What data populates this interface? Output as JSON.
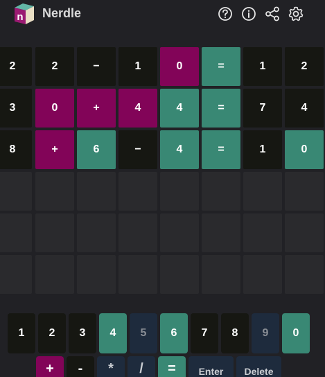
{
  "app": {
    "title": "Nerdle",
    "logo_letter": "n"
  },
  "header_icons": [
    "help-icon",
    "info-icon",
    "share-icon",
    "settings-icon"
  ],
  "colors": {
    "background": "#212125",
    "correct": "#398874",
    "wrong_position": "#820458",
    "absent": "#161712",
    "empty": "#2a2a2d",
    "key_unused": "#1e2b3d"
  },
  "board": {
    "rows": [
      [
        {
          "v": "2",
          "s": "absent"
        },
        {
          "v": "2",
          "s": "absent"
        },
        {
          "v": "−",
          "s": "absent"
        },
        {
          "v": "1",
          "s": "absent"
        },
        {
          "v": "0",
          "s": "wrong_position"
        },
        {
          "v": "=",
          "s": "correct"
        },
        {
          "v": "1",
          "s": "absent"
        },
        {
          "v": "2",
          "s": "absent"
        }
      ],
      [
        {
          "v": "3",
          "s": "absent"
        },
        {
          "v": "0",
          "s": "wrong_position"
        },
        {
          "v": "+",
          "s": "wrong_position"
        },
        {
          "v": "4",
          "s": "wrong_position"
        },
        {
          "v": "4",
          "s": "correct"
        },
        {
          "v": "=",
          "s": "correct"
        },
        {
          "v": "7",
          "s": "absent"
        },
        {
          "v": "4",
          "s": "absent"
        }
      ],
      [
        {
          "v": "8",
          "s": "absent"
        },
        {
          "v": "+",
          "s": "wrong_position"
        },
        {
          "v": "6",
          "s": "correct"
        },
        {
          "v": "−",
          "s": "absent"
        },
        {
          "v": "4",
          "s": "correct"
        },
        {
          "v": "=",
          "s": "correct"
        },
        {
          "v": "1",
          "s": "absent"
        },
        {
          "v": "0",
          "s": "correct"
        }
      ],
      [
        {
          "v": "",
          "s": "empty"
        },
        {
          "v": "",
          "s": "empty"
        },
        {
          "v": "",
          "s": "empty"
        },
        {
          "v": "",
          "s": "empty"
        },
        {
          "v": "",
          "s": "empty"
        },
        {
          "v": "",
          "s": "empty"
        },
        {
          "v": "",
          "s": "empty"
        },
        {
          "v": "",
          "s": "empty"
        }
      ],
      [
        {
          "v": "",
          "s": "empty"
        },
        {
          "v": "",
          "s": "empty"
        },
        {
          "v": "",
          "s": "empty"
        },
        {
          "v": "",
          "s": "empty"
        },
        {
          "v": "",
          "s": "empty"
        },
        {
          "v": "",
          "s": "empty"
        },
        {
          "v": "",
          "s": "empty"
        },
        {
          "v": "",
          "s": "empty"
        }
      ],
      [
        {
          "v": "",
          "s": "empty"
        },
        {
          "v": "",
          "s": "empty"
        },
        {
          "v": "",
          "s": "empty"
        },
        {
          "v": "",
          "s": "empty"
        },
        {
          "v": "",
          "s": "empty"
        },
        {
          "v": "",
          "s": "empty"
        },
        {
          "v": "",
          "s": "empty"
        },
        {
          "v": "",
          "s": "empty"
        }
      ]
    ]
  },
  "keyboard": {
    "row1": [
      {
        "label": "1",
        "state": "absent"
      },
      {
        "label": "2",
        "state": "absent"
      },
      {
        "label": "3",
        "state": "absent"
      },
      {
        "label": "4",
        "state": "correct"
      },
      {
        "label": "5",
        "state": "unused"
      },
      {
        "label": "6",
        "state": "correct"
      },
      {
        "label": "7",
        "state": "absent"
      },
      {
        "label": "8",
        "state": "absent"
      },
      {
        "label": "9",
        "state": "unused"
      },
      {
        "label": "0",
        "state": "correct"
      }
    ],
    "row2": [
      {
        "label": "+",
        "state": "wrong_position"
      },
      {
        "label": "-",
        "state": "absent"
      },
      {
        "label": "*",
        "state": "unused_dark"
      },
      {
        "label": "/",
        "state": "unused_dark"
      },
      {
        "label": "=",
        "state": "correct"
      },
      {
        "label": "Enter",
        "state": "unused_dark"
      },
      {
        "label": "Delete",
        "state": "unused_dark"
      }
    ]
  }
}
